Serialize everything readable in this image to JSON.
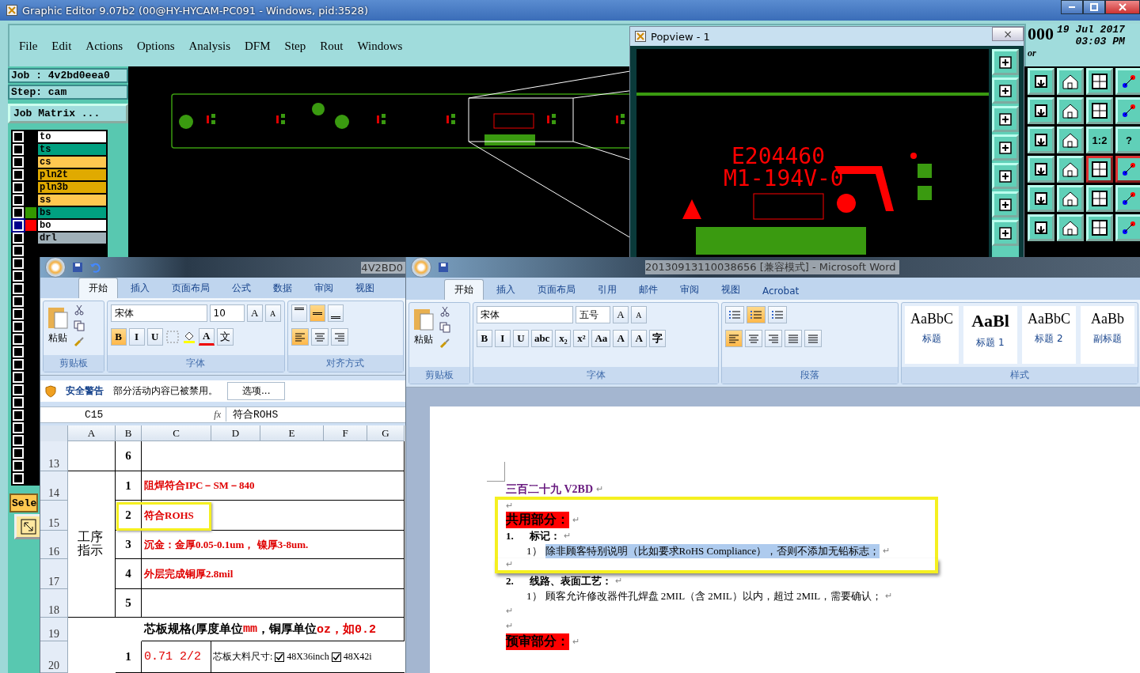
{
  "editor": {
    "title": "Graphic Editor 9.07b2 (00@HY-HYCAM-PC091 - Windows, pid:3528)",
    "menu": [
      "File",
      "Edit",
      "Actions",
      "Options",
      "Analysis",
      "DFM",
      "Step",
      "Rout",
      "Windows"
    ],
    "job": "Job : 4v2bd0eea0",
    "step": "Step: cam",
    "job_matrix": "Job Matrix ...",
    "layers": [
      {
        "name": "to",
        "color": "#ffffff",
        "selected": false
      },
      {
        "name": "ts",
        "color": "#00a080",
        "selected": false
      },
      {
        "name": "cs",
        "color": "#ffc850",
        "selected": false
      },
      {
        "name": "pln2t",
        "color": "#e0aa00",
        "selected": false
      },
      {
        "name": "pln3b",
        "color": "#e0aa00",
        "selected": false
      },
      {
        "name": "ss",
        "color": "#ffc850",
        "selected": false
      },
      {
        "name": "bs",
        "color": "#00a080",
        "swatch": {
          "color": "#339900"
        },
        "selected": false
      },
      {
        "name": "bo",
        "color": "#ffffff",
        "swatch": {
          "color": "#ff0000"
        },
        "selected": true
      },
      {
        "name": "drl",
        "color": "#a0b0b8",
        "selected": false
      }
    ],
    "empty_rows": [
      {
        "selected": false
      },
      {
        "selected": false
      },
      {
        "selected": false
      },
      {
        "selected": false
      },
      {
        "selected": false
      },
      {
        "selected": false
      },
      {
        "selected": false
      },
      {
        "selected": false
      },
      {
        "selected": false
      },
      {
        "selected": false
      },
      {
        "selected": false
      },
      {
        "selected": false
      },
      {
        "selected": false
      },
      {
        "selected": false
      },
      {
        "selected": false
      },
      {
        "selected": false
      },
      {
        "selected": false
      },
      {
        "selected": false
      },
      {
        "selected": false
      }
    ],
    "select_button": "Sele",
    "clock": {
      "counter": "000",
      "date": "19 Jul 2017",
      "time": "03:03 PM",
      "status": "or"
    },
    "tools": [
      {
        "kind": "icon"
      },
      {
        "kind": "icon"
      },
      {
        "kind": "icon"
      },
      {
        "kind": "icon"
      },
      {
        "kind": "icon"
      },
      {
        "kind": "icon"
      },
      {
        "kind": "icon"
      },
      {
        "kind": "icon"
      },
      {
        "kind": "icon"
      },
      {
        "kind": "icon"
      },
      {
        "kind": "glyph",
        "glyph": "1:2"
      },
      {
        "kind": "glyph",
        "glyph": "?"
      },
      {
        "kind": "icon"
      },
      {
        "kind": "icon"
      },
      {
        "kind": "icon"
      },
      {
        "kind": "icon"
      },
      {
        "kind": "icon"
      },
      {
        "kind": "icon"
      },
      {
        "kind": "icon"
      },
      {
        "kind": "icon"
      },
      {
        "kind": "icon"
      },
      {
        "kind": "icon"
      },
      {
        "kind": "icon"
      },
      {
        "kind": "icon"
      }
    ]
  },
  "popview": {
    "title": "Popview - 1",
    "close": "×",
    "markings": [
      "E204460",
      "M1-194V-0"
    ]
  },
  "excel": {
    "title": "4V2BD0",
    "tabs": [
      {
        "label": "开始",
        "selected": true
      },
      {
        "label": "插入",
        "selected": false
      },
      {
        "label": "页面布局",
        "selected": false
      },
      {
        "label": "公式",
        "selected": false
      },
      {
        "label": "数据",
        "selected": false
      },
      {
        "label": "审阅",
        "selected": false
      },
      {
        "label": "视图",
        "selected": false
      }
    ],
    "paste": "粘贴",
    "font": "宋体",
    "size": "10",
    "grow": [
      "A",
      "A"
    ],
    "font_buttons": [
      {
        "label": "B",
        "selected": true
      },
      {
        "label": "I",
        "selected": false
      },
      {
        "label": "U",
        "selected": false
      }
    ],
    "color_button": "A",
    "phonetic": "文",
    "valign": [
      {
        "selected": false
      },
      {
        "selected": true
      },
      {
        "selected": false
      }
    ],
    "halign": [
      {
        "selected": true
      },
      {
        "selected": false
      },
      {
        "selected": false
      }
    ],
    "groups": [
      "剪贴板",
      "字体",
      "对齐方式"
    ],
    "security": {
      "title": "安全警告",
      "message": "部分活动内容已被禁用。",
      "button": "选项..."
    },
    "name_box": "C15",
    "fx": "fx",
    "formula": "符合ROHS",
    "columns": [
      "A",
      "B",
      "C",
      "D",
      "E",
      "F",
      "G"
    ],
    "merged_label": "工序指示",
    "rows": [
      {
        "num": "13",
        "item": "6",
        "text": [],
        "highlighted": false
      },
      {
        "num": "14",
        "item": "1",
        "text": [
          {
            "t": "阻焊符合IPC－SM－840",
            "red": true
          }
        ],
        "highlighted": false
      },
      {
        "num": "15",
        "item": "2",
        "text": [
          {
            "t": "符合ROHS",
            "red": true
          }
        ],
        "highlighted": true
      },
      {
        "num": "16",
        "item": "3",
        "text": [
          {
            "t": "沉金：金厚0.05-0.1um， 镍厚3-8um.",
            "red": true
          }
        ],
        "highlighted": false
      },
      {
        "num": "17",
        "item": "4",
        "text": [
          {
            "t": "外层完成铜厚2.8mil",
            "red": true
          }
        ],
        "highlighted": false
      },
      {
        "num": "18",
        "item": "5",
        "text": [],
        "highlighted": false
      }
    ],
    "spec_row": {
      "num": "19",
      "text": [
        {
          "t": "芯板规格(厚度单位",
          "red": false
        },
        {
          "t": "mm",
          "red": true
        },
        {
          "t": "，铜厚单位",
          "red": false
        },
        {
          "t": "oz，如0.2",
          "red": true
        }
      ]
    },
    "last_row": {
      "num": "20",
      "item": "1",
      "value": "0.71  2/2",
      "label": "芯板大料尺寸:",
      "options": [
        {
          "label": "48X36inch",
          "checked": true
        },
        {
          "label": "48X42i",
          "checked": true
        }
      ]
    }
  },
  "word": {
    "title": "20130913110038656 [兼容模式] - Microsoft Word",
    "tabs": [
      {
        "label": "开始",
        "selected": true
      },
      {
        "label": "插入",
        "selected": false
      },
      {
        "label": "页面布局",
        "selected": false
      },
      {
        "label": "引用",
        "selected": false
      },
      {
        "label": "邮件",
        "selected": false
      },
      {
        "label": "审阅",
        "selected": false
      },
      {
        "label": "视图",
        "selected": false
      },
      {
        "label": "Acrobat",
        "selected": false
      }
    ],
    "paste": "粘贴",
    "font": "宋体",
    "size": "五号",
    "grow": [
      "A",
      "A"
    ],
    "font_buttons": [
      {
        "label": "B"
      },
      {
        "label": "I"
      },
      {
        "label": "U"
      },
      {
        "label": "abc"
      },
      {
        "label": "x₂"
      },
      {
        "label": "x²"
      },
      {
        "label": "Aa"
      }
    ],
    "extra_buttons": [
      "A",
      "A",
      "字"
    ],
    "numbering": [
      {
        "selected": false
      },
      {
        "selected": true
      },
      {
        "selected": false
      }
    ],
    "align": [
      {
        "selected": true
      },
      {
        "selected": false
      },
      {
        "selected": false
      },
      {
        "selected": false
      },
      {
        "selected": false
      }
    ],
    "styles": [
      {
        "sample": "AaBbC",
        "label": "标题",
        "large": false
      },
      {
        "sample": "AaBl",
        "label": "标题 1",
        "large": true
      },
      {
        "sample": "AaBbC",
        "label": "标题 2",
        "large": false
      },
      {
        "sample": "AaBb",
        "label": "副标题",
        "large": false
      }
    ],
    "groups": [
      "剪贴板",
      "字体",
      "段落",
      "样式"
    ],
    "paragraphs": [
      {
        "kind": "title",
        "text": "三百二十九 V2BD",
        "mark": "↵",
        "framed": false
      },
      {
        "kind": "empty",
        "mark": "↵",
        "framed": true
      },
      {
        "kind": "heading",
        "text": "共用部分：",
        "mark": "↵",
        "framed": true
      },
      {
        "kind": "numbered",
        "num": "1.",
        "text": "标记：",
        "mark": "↵",
        "framed": true
      },
      {
        "kind": "sub",
        "num": "1）",
        "text": "除非顾客特别说明（比如要求RoHS Compliance），否则不添加无铅标志；",
        "mark": "↵",
        "framed": true,
        "selected": true
      },
      {
        "kind": "empty",
        "mark": "↵",
        "framed": true
      },
      {
        "kind": "numbered",
        "num": "2.",
        "text": "线路、表面工艺：",
        "mark": "↵",
        "framed": false
      },
      {
        "kind": "sub",
        "num": "1）",
        "text": "顾客允许修改器件孔焊盘 2MIL（含 2MIL）以内，超过 2MIL，需要确认；",
        "mark": "↵",
        "framed": false,
        "selected": false
      },
      {
        "kind": "empty",
        "mark": "↵",
        "framed": false
      },
      {
        "kind": "empty",
        "mark": "↵",
        "framed": false
      },
      {
        "kind": "heading",
        "text": "预审部分：",
        "mark": "↵",
        "framed": false
      }
    ]
  }
}
